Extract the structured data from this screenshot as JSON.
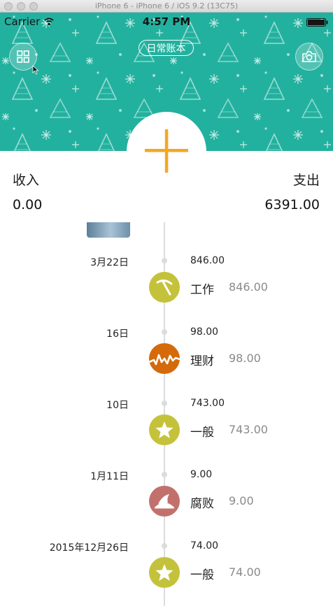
{
  "window": {
    "title": "iPhone 6 - iPhone 6 / iOS 9.2 (13C75)"
  },
  "status_bar": {
    "carrier": "Carrier",
    "time": "4:57 PM"
  },
  "header": {
    "book_title": "日常账本",
    "left_icon": "grid-icon",
    "right_icon": "camera-icon",
    "add_icon": "plus-icon",
    "background_color": "#23b19f",
    "accent_color": "#f5a623"
  },
  "summary": {
    "income_label": "收入",
    "income_value": "0.00",
    "expense_label": "支出",
    "expense_value": "6391.00"
  },
  "entries": [
    {
      "date": "3月22日",
      "total": "846.00",
      "category": "工作",
      "amount": "846.00",
      "icon": "pickaxe-icon",
      "color": "#c4c23a"
    },
    {
      "date": "16日",
      "total": "98.00",
      "category": "理财",
      "amount": "98.00",
      "icon": "stock-chart-icon",
      "color": "#d46a0a"
    },
    {
      "date": "10日",
      "total": "743.00",
      "category": "一般",
      "amount": "743.00",
      "icon": "star-icon",
      "color": "#c4c23a"
    },
    {
      "date": "1月11日",
      "total": "9.00",
      "category": "腐败",
      "amount": "9.00",
      "icon": "food-plate-icon",
      "color": "#c2706c"
    },
    {
      "date": "2015年12月26日",
      "total": "74.00",
      "category": "一般",
      "amount": "74.00",
      "icon": "star-icon",
      "color": "#c4c23a"
    }
  ]
}
